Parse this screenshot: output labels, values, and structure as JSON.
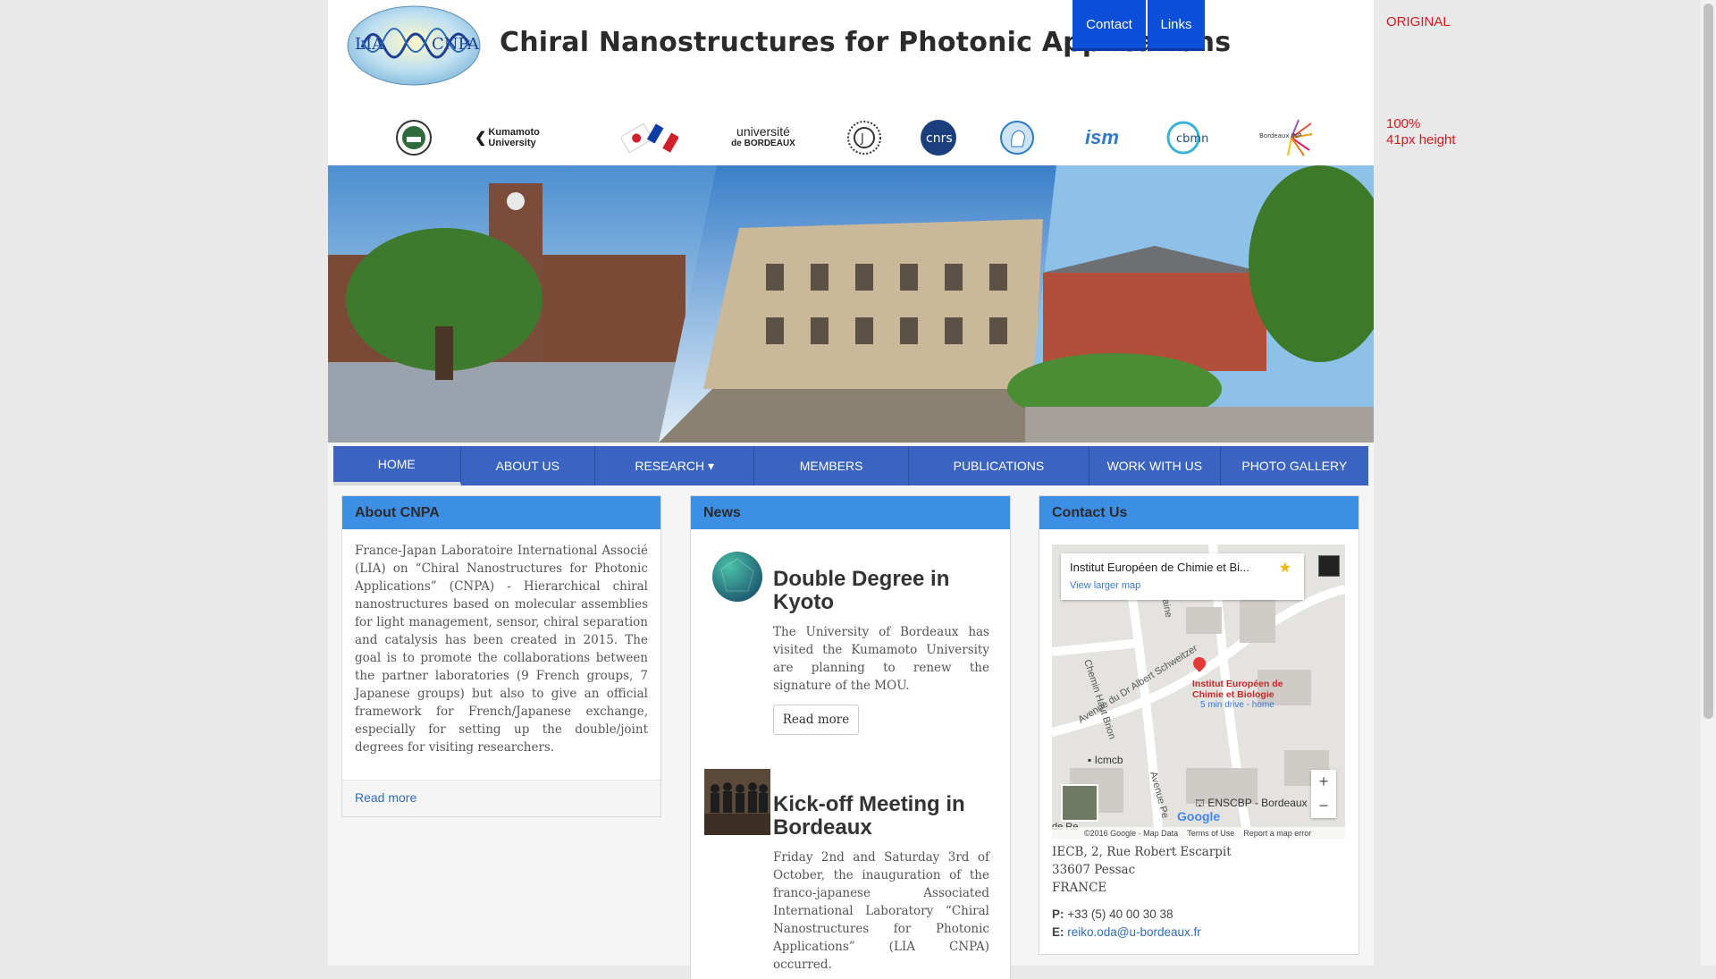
{
  "header": {
    "logo_text_left": "LIA",
    "logo_text_right": "CNPA",
    "title": "Chiral Nanostructures for Photonic Applications",
    "buttons": [
      {
        "label": "Contact"
      },
      {
        "label": "Links"
      }
    ]
  },
  "side_notes": {
    "original": "ORIGINAL",
    "percent": "100%",
    "height": "41px height"
  },
  "partners": [
    {
      "name": "kyoto-university-seal-icon"
    },
    {
      "name": "kumamoto-university-logo",
      "text": "Kumamoto University"
    },
    {
      "name": "japan-france-flags-icon"
    },
    {
      "name": "universite-bordeaux-logo",
      "text1": "université",
      "text2": "de BORDEAUX"
    },
    {
      "name": "excellence-j-seal-icon",
      "text": "J"
    },
    {
      "name": "cnrs-logo",
      "text": "cnrs"
    },
    {
      "name": "institute-profile-logo"
    },
    {
      "name": "ism-logo",
      "text": "ism"
    },
    {
      "name": "cbmn-logo",
      "text": "cbmn"
    },
    {
      "name": "bordeaux-inp-logo",
      "text": "Bordeaux INP"
    }
  ],
  "nav": {
    "items": [
      {
        "label": "HOME",
        "active": true
      },
      {
        "label": "ABOUT US"
      },
      {
        "label": "RESEARCH ▾"
      },
      {
        "label": "MEMBERS"
      },
      {
        "label": "PUBLICATIONS"
      },
      {
        "label": "WORK WITH US"
      },
      {
        "label": "PHOTO GALLERY"
      }
    ]
  },
  "about": {
    "heading": "About CNPA",
    "text": "France-Japan Laboratoire International Associé (LIA) on “Chiral Nanostructures for Photonic Applications” (CNPA) - Hierarchical chiral nanostructures based on molecular assemblies for light management, sensor, chiral separation and catalysis has been created in 2015. The goal is to promote the collaborations between the partner laboratories (9 French groups, 7 Japanese groups) but also to give an official framework for French/Japanese exchange, especially for setting up the double/joint degrees for visiting researchers.",
    "read_more": "Read more"
  },
  "news": {
    "heading": "News",
    "items": [
      {
        "title": "Double Degree in Kyoto",
        "text": "The University of Bordeaux has visited the Kumamoto University are planning to renew the signature of the MOU.",
        "button": "Read more"
      },
      {
        "title": "Kick-off Meeting in Bordeaux",
        "text": "Friday 2nd and Saturday 3rd of October, the inauguration of the franco-japanese Associated International Laboratory “Chiral Nanostructures for Photonic Applications” (LIA CNPA) occurred."
      }
    ]
  },
  "contact": {
    "heading": "Contact Us",
    "map": {
      "place": "Institut Européen de Chimie et Bi...",
      "larger": "View larger map",
      "marker_label_1": "Institut Européen de",
      "marker_label_2": "Chimie et Biologie",
      "drive": "5 min drive - home",
      "street1": "Avenue du Dr Albert Schweitzer",
      "street2": "Avenue Pe",
      "street3": "Chemin Haut Brion",
      "street4": "Fontaine",
      "poi1": "Icmcb",
      "poi2": "ENSCBP - Bordeaux",
      "road": "de Re",
      "copyright": "©2016 Google · Map Data",
      "terms": "Terms of Use",
      "report": "Report a map error",
      "zoom_in": "+",
      "zoom_out": "−",
      "brand": "Google"
    },
    "address": [
      "IECB, 2, Rue Robert Escarpit",
      "33607 Pessac",
      "FRANCE"
    ],
    "phone_label": "P:",
    "phone": "+33 (5) 40 00 30 38",
    "email_label": "E:",
    "email": "reiko.oda@u-bordeaux.fr"
  },
  "colors": {
    "nav": "#3a63c2",
    "panel_head": "#3d8fe6",
    "top_button": "#0b4fd8",
    "note_red": "#d9171e"
  }
}
